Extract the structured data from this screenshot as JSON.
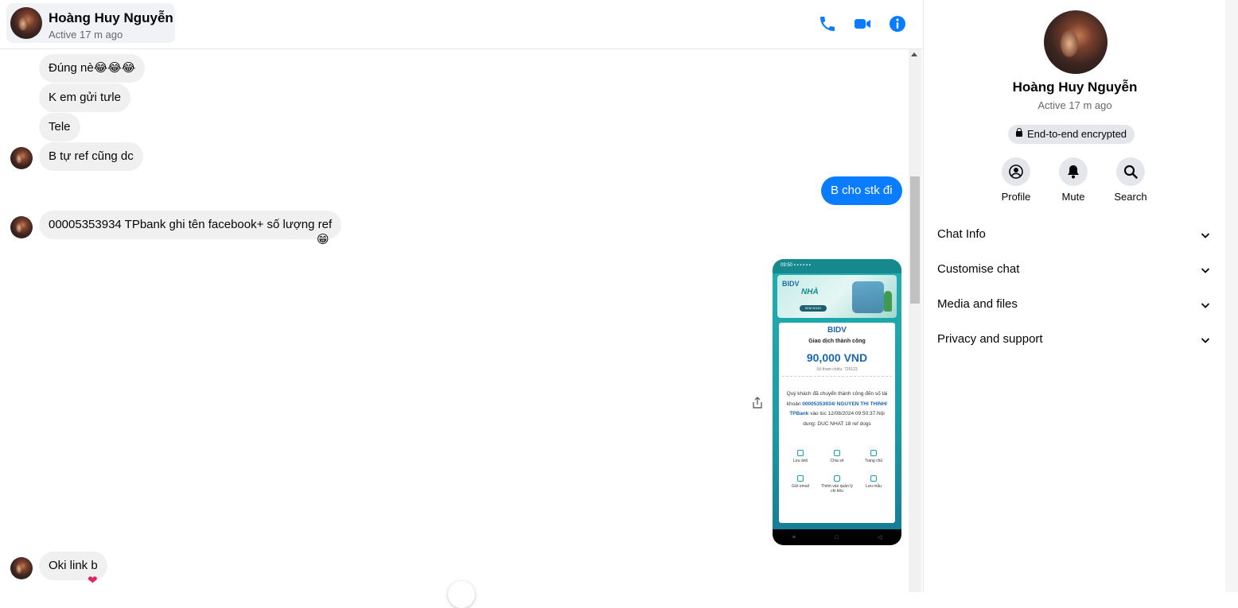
{
  "header": {
    "name": "Hoàng Huy Nguyễn",
    "status": "Active 17 m ago",
    "icons": [
      "phone-icon",
      "video-icon",
      "info-icon"
    ]
  },
  "messages": [
    {
      "direction": "in",
      "text": "Đúng nè😂😂😂"
    },
    {
      "direction": "in",
      "text": "K em gửi tưle"
    },
    {
      "direction": "in",
      "text": "Tele"
    },
    {
      "direction": "in",
      "text": "B tự ref cũng dc"
    },
    {
      "direction": "out",
      "text": "B cho stk đi"
    },
    {
      "direction": "in",
      "text": "00005353934 TPbank ghi tên facebook+ số lượng ref",
      "reaction": "😁"
    },
    {
      "direction": "out",
      "type": "image"
    },
    {
      "direction": "in",
      "text": "Oki link b",
      "reaction": "❤️"
    }
  ],
  "receipt": {
    "status_bar": "09:50 ▪ ▪ ▪ ▪ ▪ ▪",
    "banner_brand": "BIDV",
    "banner_title": "NHÀ",
    "banner_button": "XEM NGAY",
    "brand": "BIDV",
    "status": "Giao dịch thành công",
    "amount": "90,000 VND",
    "ref": "Số tham chiếu: 726123",
    "body_pre": "Quý khách đã chuyển thành công đến số tài khoản ",
    "account": "00005353934/ NGUYEN THI THINH/ TPBank",
    "body_post": " vào lúc 12/08/2024 09:50:37.Nội dung: DUC NHAT 18 ref dogs",
    "actions_row1": [
      "Lưu ảnh",
      "Chia sẻ",
      "Trang chủ"
    ],
    "actions_row2": [
      "Gửi email",
      "Thêm vào quản lý chi tiêu",
      "Lưu mẫu"
    ],
    "nav": [
      "≡",
      "□",
      "◁"
    ]
  },
  "panel": {
    "name": "Hoàng Huy Nguyễn",
    "status": "Active 17 m ago",
    "encryption": "End-to-end encrypted",
    "actions": [
      {
        "label": "Profile",
        "icon": "profile-icon"
      },
      {
        "label": "Mute",
        "icon": "bell-icon"
      },
      {
        "label": "Search",
        "icon": "search-icon"
      }
    ],
    "sections": [
      "Chat Info",
      "Customise chat",
      "Media and files",
      "Privacy and support"
    ]
  },
  "colors": {
    "accent": "#0a7cff",
    "incoming_bubble": "#f0f0f0",
    "secondary_text": "#65676b"
  }
}
